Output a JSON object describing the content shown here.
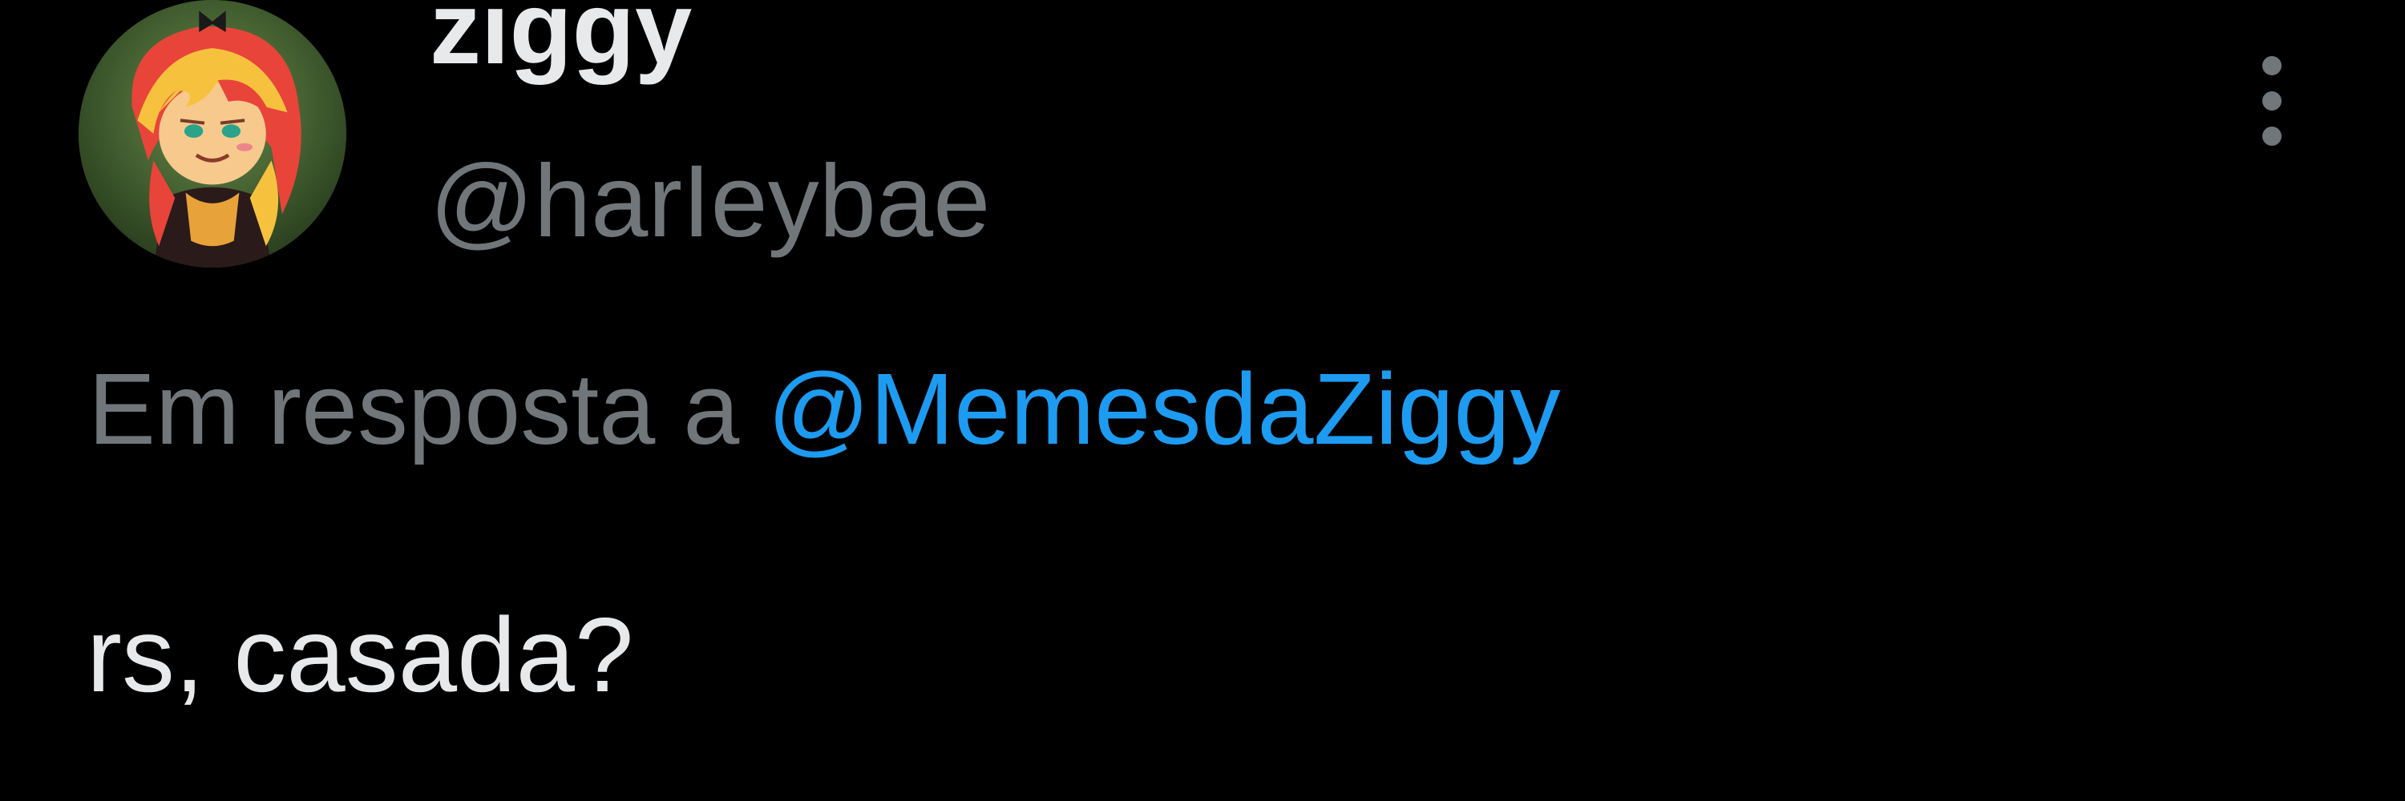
{
  "tweet": {
    "display_name": "ziggy",
    "handle": "@harIeybae",
    "avatar_icon": "profile-avatar-cartoon-girl",
    "more_icon": "more-vertical-icon",
    "reply_prefix": "Em resposta a",
    "reply_to": "@MemesdaZiggy",
    "text": "rs, casada?"
  },
  "colors": {
    "background": "#000000",
    "primary_text": "#e7e9ea",
    "secondary_text": "#71767b",
    "link": "#1d9bf0"
  }
}
